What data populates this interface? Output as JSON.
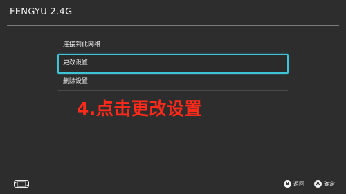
{
  "header": {
    "title": "FENGYU 2.4G"
  },
  "menu": {
    "items": [
      {
        "label": "连接到此网络"
      },
      {
        "label": "更改设置",
        "selected": true
      },
      {
        "label": "删除设置"
      }
    ]
  },
  "annotation": {
    "text": "4.点击更改设置",
    "color": "#ff2a1a"
  },
  "footer": {
    "controller_icon": "switch-console-icon",
    "actions": [
      {
        "button": "B",
        "label": "返回"
      },
      {
        "button": "A",
        "label": "确定"
      }
    ]
  },
  "colors": {
    "background": "#2d2d2d",
    "focus": "#3fc3d6",
    "text": "#ffffff"
  }
}
